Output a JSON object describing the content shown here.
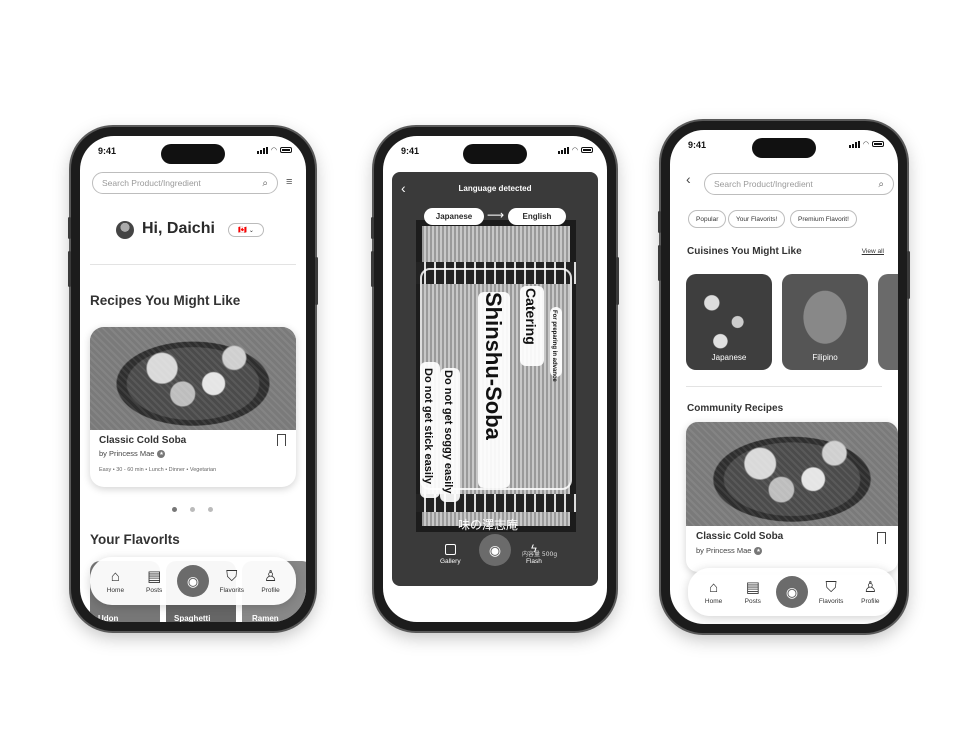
{
  "status": {
    "time": "9:41"
  },
  "phone1": {
    "search_placeholder": "Search Product/Ingredient",
    "greeting": "Hi, Daichi",
    "flag": "🇨🇦",
    "section_recipes": "Recipes You Might Like",
    "recipe": {
      "title": "Classic Cold Soba",
      "author": "by Princess Mae",
      "meta": "Easy • 30 - 60 min • Lunch • Dinner • Vegetarian"
    },
    "section_favorites": "Your Flavorlts",
    "favorites": [
      "Udon",
      "Spaghetti",
      "Ramen"
    ]
  },
  "nav": {
    "home": "Home",
    "posts": "Posts",
    "favorits": "Flavorits",
    "profile": "Profile"
  },
  "phone2": {
    "title": "Language detected",
    "from_lang": "Japanese",
    "to_lang": "English",
    "translations": {
      "main": "Shinshu-Soba",
      "catering": "Catering",
      "advance": "For preparing in advance",
      "soggy": "Do not get soggy easily",
      "stick": "Do not get stick easily"
    },
    "brand_jp": "味の澤志庵",
    "weight_jp": "内容量 500g",
    "gallery": "Gallery",
    "flash": "Flash"
  },
  "phone3": {
    "search_placeholder": "Search Product/Ingredient",
    "filters": [
      "Popular",
      "Your Flavorits!",
      "Premium Flavorit!"
    ],
    "section_cuisines": "Cuisines You Might Like",
    "view_all": "View all",
    "cuisines": [
      "Japanese",
      "Filipino"
    ],
    "section_community": "Community Recipes",
    "recipe": {
      "title": "Classic Cold Soba",
      "author": "by Princess Mae"
    }
  }
}
